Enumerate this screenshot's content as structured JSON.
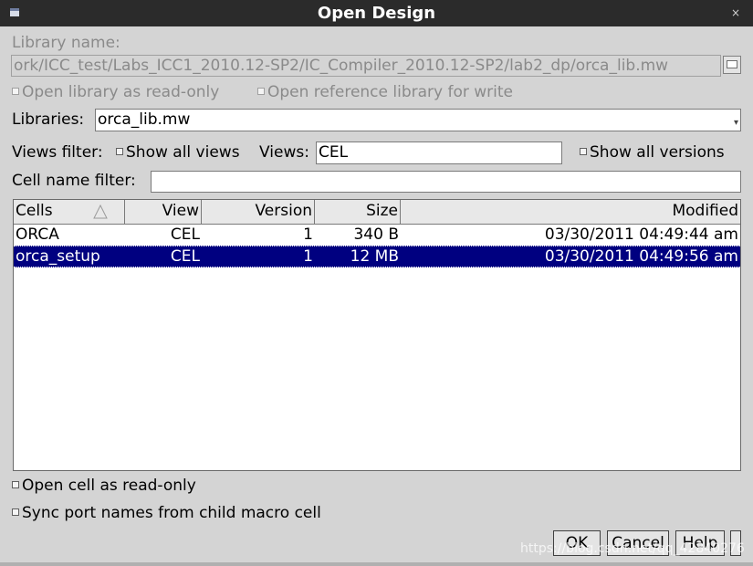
{
  "window": {
    "title": "Open Design",
    "close_glyph": "×"
  },
  "library": {
    "label": "Library name:",
    "path": "ork/ICC_test/Labs_ICC1_2010.12-SP2/IC_Compiler_2010.12-SP2/lab2_dp/orca_lib.mw"
  },
  "options": {
    "readonly_lib": "Open library as read-only",
    "ref_lib_write": "Open reference library for write"
  },
  "libraries": {
    "label": "Libraries:",
    "value": "orca_lib.mw"
  },
  "views_filter": {
    "label": "Views filter:",
    "show_all_views": "Show all views",
    "views_label": "Views:",
    "views_value": "CEL",
    "show_all_versions": "Show all versions"
  },
  "cell_filter": {
    "label": "Cell name filter:",
    "value": ""
  },
  "table": {
    "columns": [
      "Cells",
      "View",
      "Version",
      "Size",
      "Modified"
    ],
    "rows": [
      {
        "cell": "ORCA",
        "view": "CEL",
        "version": "1",
        "size": "340 B",
        "modified": "03/30/2011 04:49:44 am",
        "selected": false
      },
      {
        "cell": "orca_setup",
        "view": "CEL",
        "version": "1",
        "size": "12 MB",
        "modified": "03/30/2011 04:49:56 am",
        "selected": true
      }
    ]
  },
  "bottom_options": {
    "readonly_cell": "Open cell as read-only",
    "sync_ports": "Sync port names from child macro cell"
  },
  "buttons": {
    "ok": "OK",
    "cancel": "Cancel",
    "help": "Help"
  },
  "watermark": "https://blog.csdn.net/qq_42840276",
  "icons": [
    "window-menu-icon",
    "close-icon",
    "browse-folder-icon",
    "dropdown-arrow-icon",
    "sort-ascending-icon"
  ]
}
